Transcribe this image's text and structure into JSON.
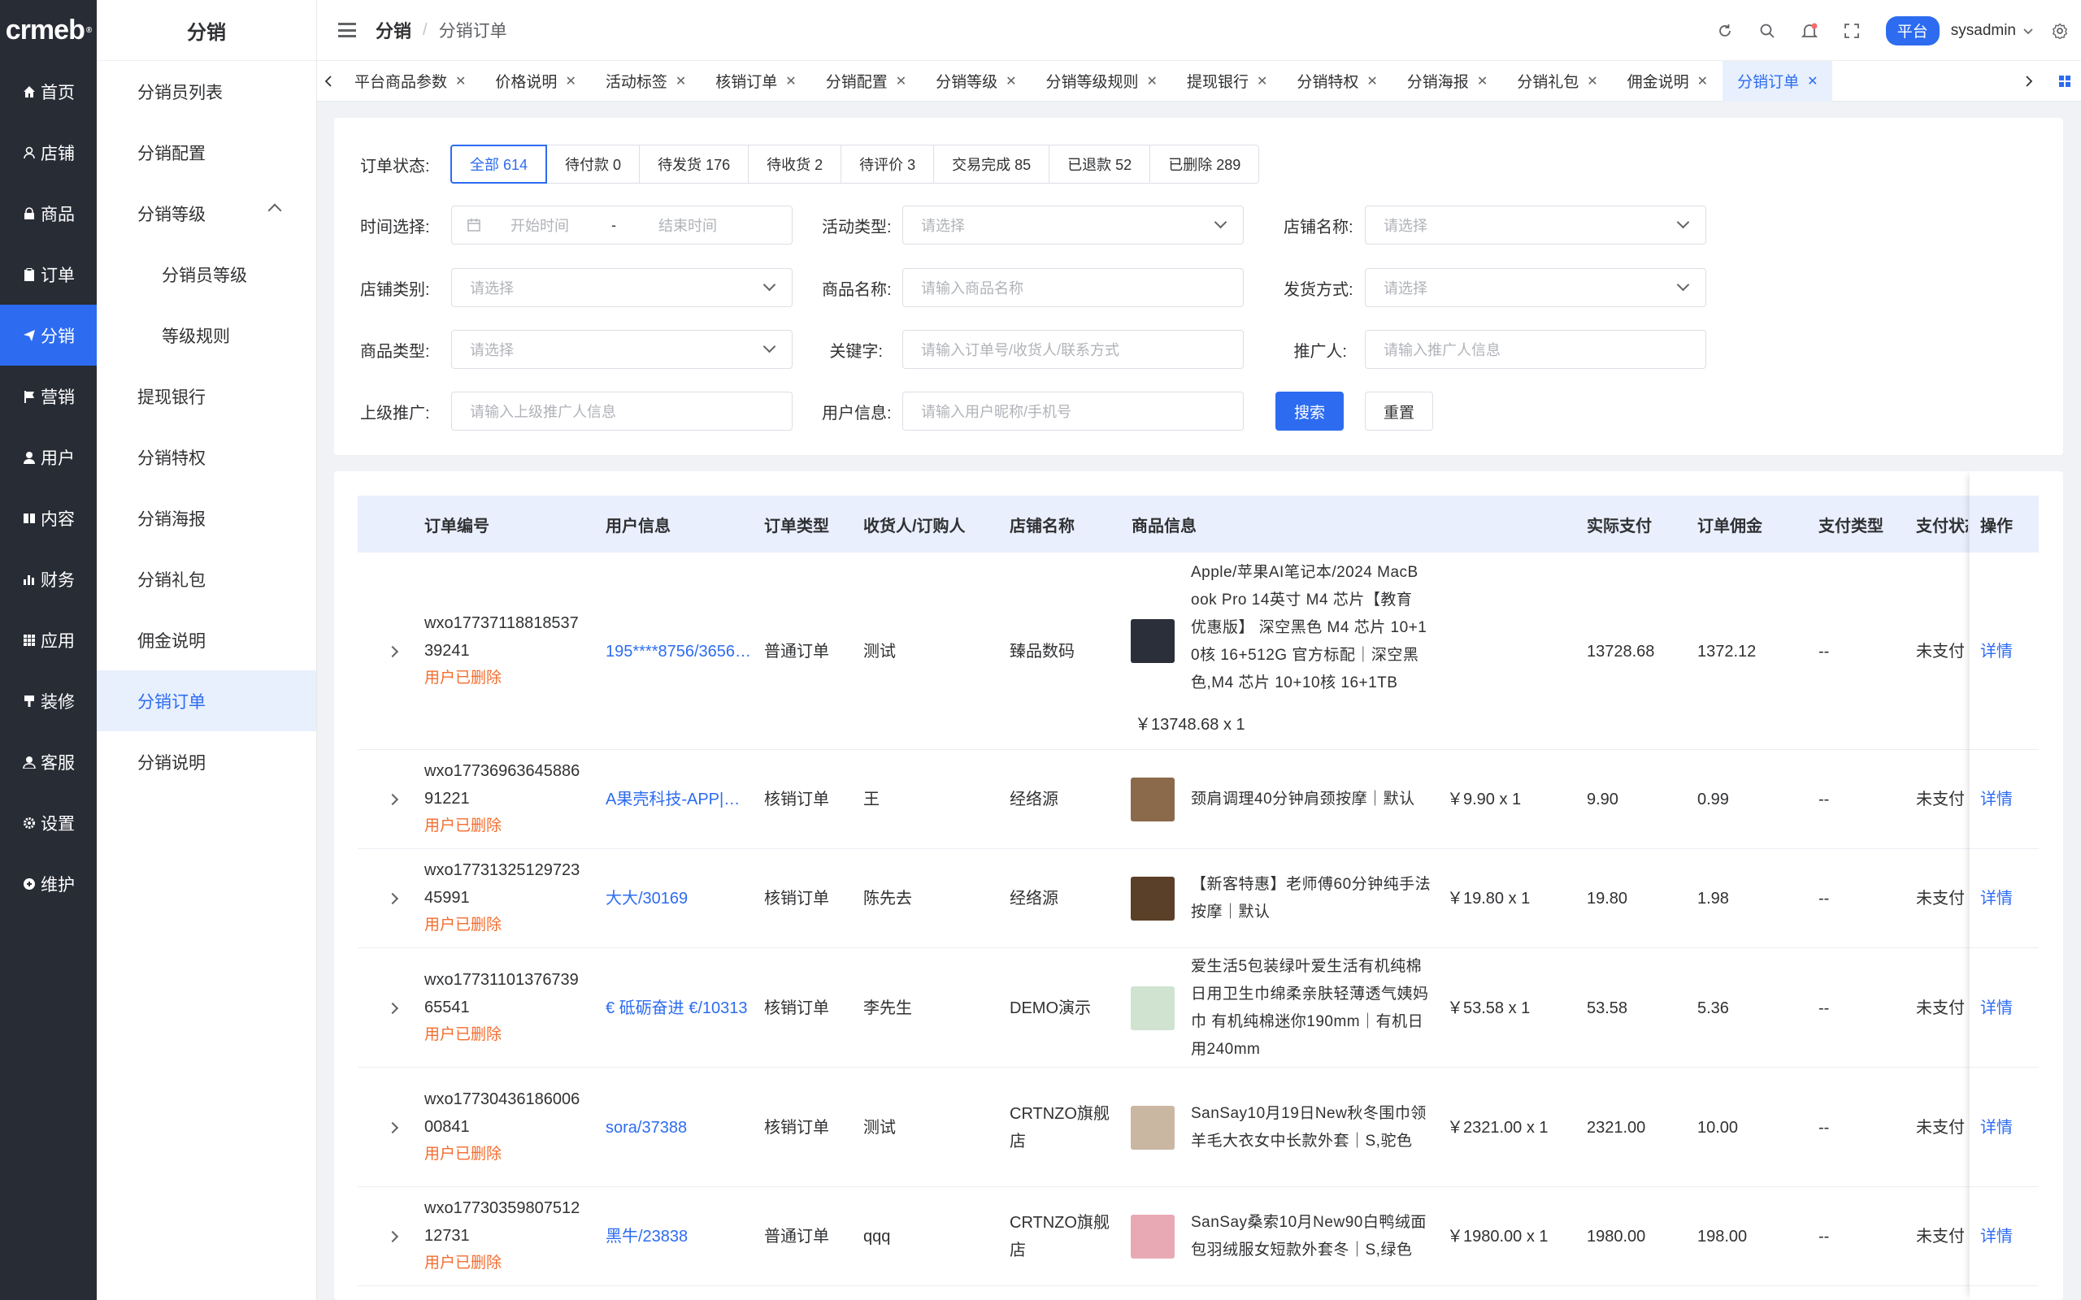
{
  "logo": {
    "text": "crmeb",
    "mark": "®"
  },
  "left_menu": [
    {
      "label": "首页",
      "icon": "home-icon"
    },
    {
      "label": "店铺",
      "icon": "user-icon"
    },
    {
      "label": "商品",
      "icon": "lock-icon"
    },
    {
      "label": "订单",
      "icon": "clipboard-icon"
    },
    {
      "label": "分销",
      "icon": "send-icon",
      "active": true
    },
    {
      "label": "营销",
      "icon": "flag-icon"
    },
    {
      "label": "用户",
      "icon": "person-icon"
    },
    {
      "label": "内容",
      "icon": "book-icon"
    },
    {
      "label": "财务",
      "icon": "bar-chart-icon"
    },
    {
      "label": "应用",
      "icon": "grid-icon"
    },
    {
      "label": "装修",
      "icon": "brush-icon"
    },
    {
      "label": "客服",
      "icon": "headset-icon"
    },
    {
      "label": "设置",
      "icon": "gear-icon"
    },
    {
      "label": "维护",
      "icon": "wrench-icon"
    }
  ],
  "sub_menu": {
    "title": "分销",
    "items": [
      {
        "label": "分销员列表"
      },
      {
        "label": "分销配置"
      },
      {
        "label": "分销等级",
        "expanded": true
      },
      {
        "label": "分销员等级",
        "child": true
      },
      {
        "label": "等级规则",
        "child": true
      },
      {
        "label": "提现银行"
      },
      {
        "label": "分销特权"
      },
      {
        "label": "分销海报"
      },
      {
        "label": "分销礼包"
      },
      {
        "label": "佣金说明"
      },
      {
        "label": "分销订单",
        "active": true
      },
      {
        "label": "分销说明"
      }
    ]
  },
  "header": {
    "breadcrumb_main": "分销",
    "breadcrumb_sep": "/",
    "breadcrumb_sub": "分销订单",
    "platform_badge": "平台",
    "username": "sysadmin"
  },
  "tabs": [
    "平台商品参数",
    "价格说明",
    "活动标签",
    "核销订单",
    "分销配置",
    "分销等级",
    "分销等级规则",
    "提现银行",
    "分销特权",
    "分销海报",
    "分销礼包",
    "佣金说明",
    "分销订单"
  ],
  "active_tab": "分销订单",
  "filter": {
    "status_label": "订单状态:",
    "statuses": [
      "全部 614",
      "待付款 0",
      "待发货 176",
      "待收货 2",
      "待评价 3",
      "交易完成 85",
      "已退款 52",
      "已删除 289"
    ],
    "time_label": "时间选择:",
    "start_placeholder": "开始时间",
    "range_sep": "-",
    "end_placeholder": "结束时间",
    "activity_label": "活动类型:",
    "activity_placeholder": "请选择",
    "store_name_label": "店铺名称:",
    "store_name_placeholder": "请选择",
    "store_type_label": "店铺类别:",
    "store_type_placeholder": "请选择",
    "goods_name_label": "商品名称:",
    "goods_name_placeholder": "请输入商品名称",
    "delivery_label": "发货方式:",
    "delivery_placeholder": "请选择",
    "goods_type_label": "商品类型:",
    "goods_type_placeholder": "请选择",
    "keyword_label": "关键字:",
    "keyword_placeholder": "请输入订单号/收货人/联系方式",
    "promoter_label": "推广人:",
    "promoter_placeholder": "请输入推广人信息",
    "upper_promoter_label": "上级推广:",
    "upper_promoter_placeholder": "请输入上级推广人信息",
    "user_info_label": "用户信息:",
    "user_info_placeholder": "请输入用户昵称/手机号",
    "search_btn": "搜索",
    "reset_btn": "重置"
  },
  "table": {
    "columns": [
      "订单编号",
      "用户信息",
      "订单类型",
      "收货人/订购人",
      "店铺名称",
      "商品信息",
      "实际支付",
      "订单佣金",
      "支付类型",
      "支付状态",
      "操作"
    ],
    "rows": [
      {
        "order_no_1": "wxo17737118818537",
        "order_no_2": "39241",
        "deleted": "用户已删除",
        "user": "195****8756/36567...",
        "type": "普通订单",
        "receiver": "测试",
        "store": "臻品数码",
        "goods_lines": [
          "Apple/苹果AI笔记本/2024 MacB",
          "ook Pro 14英寸 M4 芯片【教育",
          "优惠版】 深空黑色 M4 芯片 10+1",
          "0核 16+512G 官方标配｜深空黑",
          "色,M4 芯片 10+10核 16+1TB"
        ],
        "price_qty": "￥13748.68 x 1",
        "paid": "13728.68",
        "commission": "1372.12",
        "pay_type": "--",
        "pay_status": "未支付",
        "action": "详情",
        "thumb_color": "#2b2f3a"
      },
      {
        "order_no_1": "wxo17736963645886",
        "order_no_2": "91221",
        "deleted": "用户已删除",
        "user": "A果壳科技-APP|小程序",
        "type": "核销订单",
        "receiver": "王",
        "store": "经络源",
        "goods_lines": [
          "颈肩调理40分钟肩颈按摩｜默认"
        ],
        "price_qty": "￥9.90 x 1",
        "paid": "9.90",
        "commission": "0.99",
        "pay_type": "--",
        "pay_status": "未支付",
        "action": "详情",
        "thumb_color": "#8a6a4a"
      },
      {
        "order_no_1": "wxo17731325129723",
        "order_no_2": "45991",
        "deleted": "用户已删除",
        "user": "大大/30169",
        "type": "核销订单",
        "receiver": "陈先去",
        "store": "经络源",
        "goods_lines": [
          "【新客特惠】老师傅60分钟纯手法",
          "按摩｜默认"
        ],
        "price_qty": "￥19.80 x 1",
        "paid": "19.80",
        "commission": "1.98",
        "pay_type": "--",
        "pay_status": "未支付",
        "action": "详情",
        "thumb_color": "#5a4028"
      },
      {
        "order_no_1": "wxo17731101376739",
        "order_no_2": "65541",
        "deleted": "用户已删除",
        "user": "€ 砥砺奋进 €/10313",
        "type": "核销订单",
        "receiver": "李先生",
        "store": "DEMO演示",
        "goods_lines": [
          "爱生活5包装绿叶爱生活有机纯棉",
          "日用卫生巾绵柔亲肤轻薄透气姨妈",
          "巾 有机纯棉迷你190mm｜有机日",
          "用240mm"
        ],
        "price_qty": "￥53.58 x 1",
        "paid": "53.58",
        "commission": "5.36",
        "pay_type": "--",
        "pay_status": "未支付",
        "action": "详情",
        "thumb_color": "#cfe3d0"
      },
      {
        "order_no_1": "wxo17730436186006",
        "order_no_2": "00841",
        "deleted": "用户已删除",
        "user": "sora/37388",
        "type": "核销订单",
        "receiver": "测试",
        "store_lines": [
          "CRTNZO旗舰",
          "店"
        ],
        "goods_lines": [
          "SanSay10月19日New秋冬围巾领",
          "羊毛大衣女中长款外套｜S,驼色"
        ],
        "price_qty": "￥2321.00 x 1",
        "paid": "2321.00",
        "commission": "10.00",
        "pay_type": "--",
        "pay_status": "未支付",
        "action": "详情",
        "thumb_color": "#c9b7a2"
      },
      {
        "order_no_1": "wxo17730359807512",
        "order_no_2": "12731",
        "deleted": "用户已删除",
        "user": "黑牛/23838",
        "type": "普通订单",
        "receiver": "qqq",
        "store_lines": [
          "CRTNZO旗舰",
          "店"
        ],
        "goods_lines": [
          "SanSay桑索10月New90白鸭绒面",
          "包羽绒服女短款外套冬｜S,绿色"
        ],
        "price_qty": "￥1980.00 x 1",
        "paid": "1980.00",
        "commission": "198.00",
        "pay_type": "--",
        "pay_status": "未支付",
        "action": "详情",
        "thumb_color": "#e8a9b5"
      }
    ]
  },
  "colors": {
    "primary": "#2d6cf0",
    "sidebar": "#282c35",
    "danger": "#f56c2d"
  }
}
